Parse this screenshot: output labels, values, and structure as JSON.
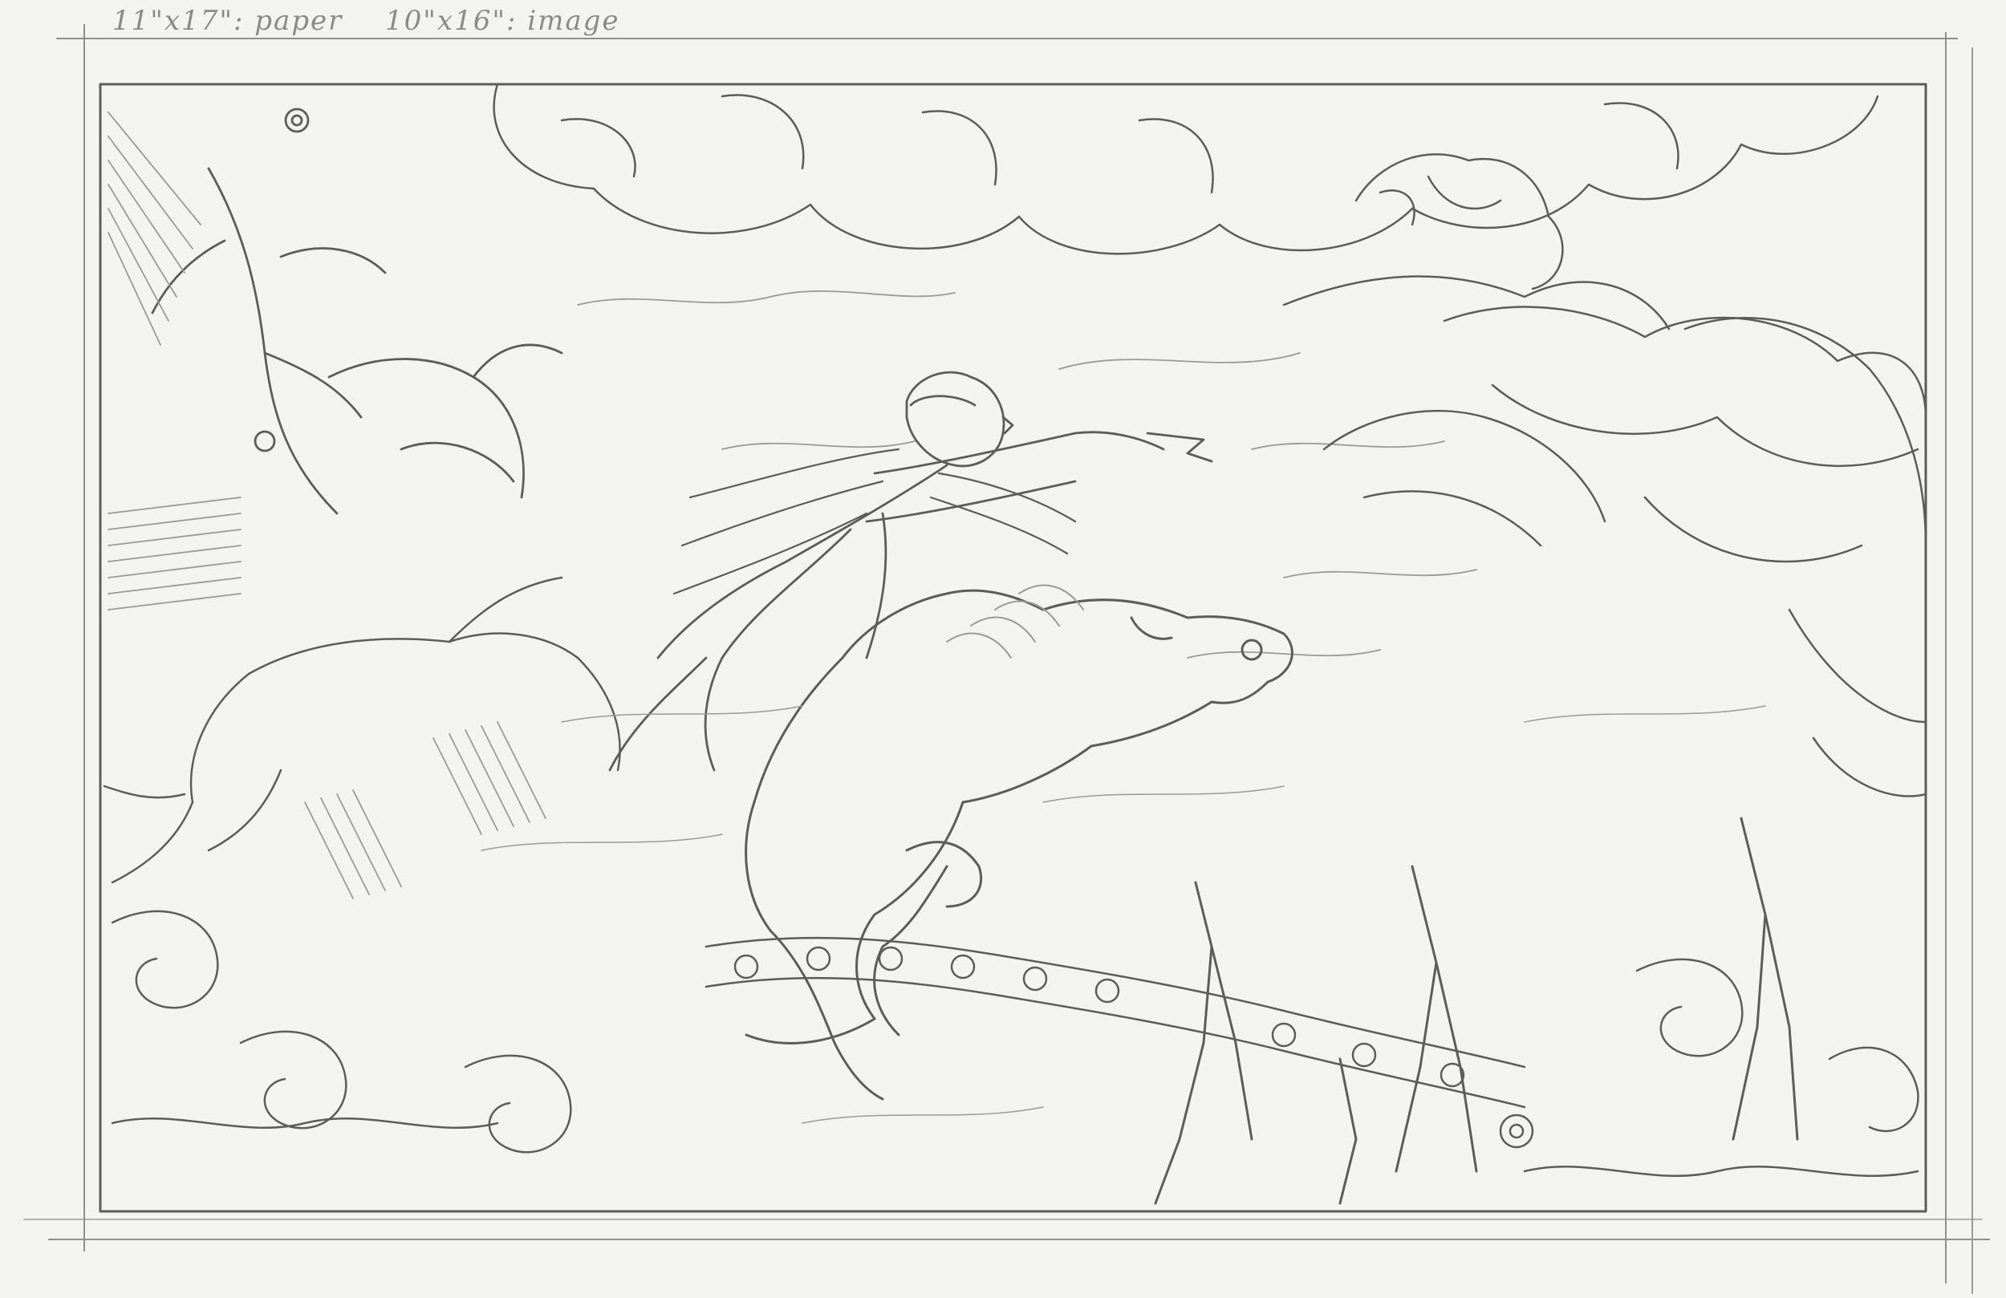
{
  "notes": {
    "paper": "11\"x17\": paper",
    "image": "10\"x16\": image"
  },
  "palette": {
    "paper": "#f3f3f2",
    "graphite": "#5c5c5c",
    "graphite_light": "#9a9a9a"
  }
}
